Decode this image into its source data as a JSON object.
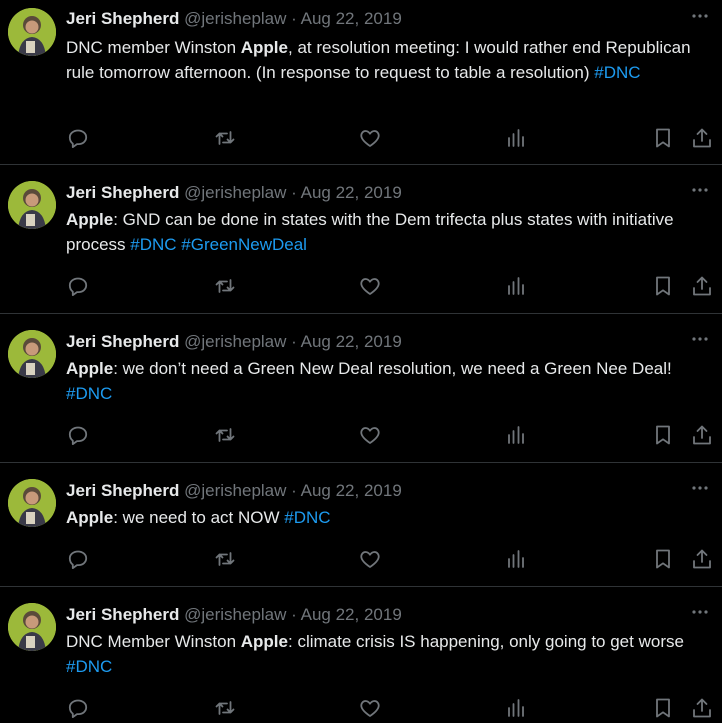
{
  "colors": {
    "background": "#000000",
    "text": "#e7e9ea",
    "muted": "#71767b",
    "link": "#1d9bf0",
    "divider": "#2f3336"
  },
  "icons": [
    "more-icon",
    "reply-icon",
    "retweet-icon",
    "like-icon",
    "views-icon",
    "bookmark-icon",
    "share-icon"
  ],
  "tweets": [
    {
      "author": "Jeri Shepherd",
      "handle": "@jerisheplaw",
      "separator": "·",
      "date": "Aug 22, 2019",
      "text": {
        "pre": "DNC member Winston ",
        "bold": "Apple",
        "post": ", at resolution meeting: I would rather end Republican rule tomorrow afternoon. (In response to request to table a resolution) ",
        "tags": [
          "#DNC"
        ]
      }
    },
    {
      "author": "Jeri Shepherd",
      "handle": "@jerisheplaw",
      "separator": "·",
      "date": "Aug 22, 2019",
      "text": {
        "pre": "",
        "bold": "Apple",
        "post": ": GND can be done in states with the Dem trifecta plus states with initiative process ",
        "tags": [
          "#DNC",
          "#GreenNewDeal"
        ]
      }
    },
    {
      "author": "Jeri Shepherd",
      "handle": "@jerisheplaw",
      "separator": "·",
      "date": "Aug 22, 2019",
      "text": {
        "pre": "",
        "bold": "Apple",
        "post": ": we don’t need a Green New Deal resolution, we need a Green Nee Deal! ",
        "tags": [
          "#DNC"
        ]
      }
    },
    {
      "author": "Jeri Shepherd",
      "handle": "@jerisheplaw",
      "separator": "·",
      "date": "Aug 22, 2019",
      "text": {
        "pre": "",
        "bold": "Apple",
        "post": ": we need to act NOW ",
        "tags": [
          "#DNC"
        ]
      }
    },
    {
      "author": "Jeri Shepherd",
      "handle": "@jerisheplaw",
      "separator": "·",
      "date": "Aug 22, 2019",
      "text": {
        "pre": "DNC Member Winston ",
        "bold": "Apple",
        "post": ": climate crisis IS happening, only going to get worse ",
        "tags": [
          "#DNC"
        ]
      }
    }
  ]
}
